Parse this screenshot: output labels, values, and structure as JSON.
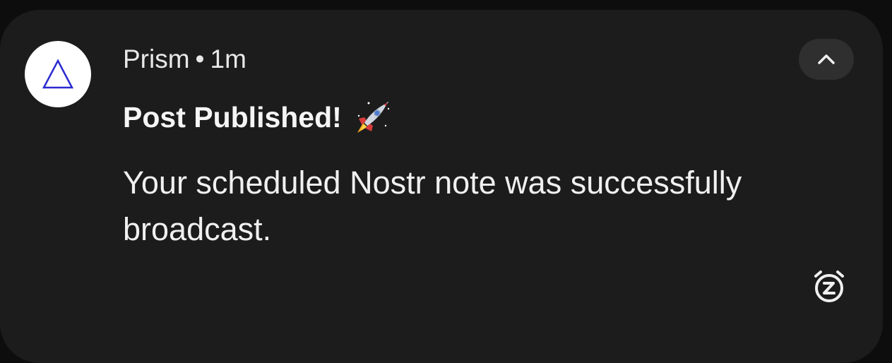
{
  "notification": {
    "app_name": "Prism",
    "separator": "•",
    "time_ago": "1m",
    "title": "Post Published!",
    "title_emoji": "rocket-emoji",
    "body": "Your scheduled Nostr note was successfully broadcast.",
    "app_icon": "triangle-icon",
    "collapse_icon": "chevron-up-icon",
    "snooze_icon": "snooze-icon"
  },
  "colors": {
    "card_background": "#1c1c1c",
    "screen_background": "#0d0d0d",
    "text_primary": "#f1f1f1",
    "app_icon_stroke": "#2a2ad0",
    "avatar_background": "#ffffff",
    "collapse_button_background": "#2f2f2f"
  }
}
